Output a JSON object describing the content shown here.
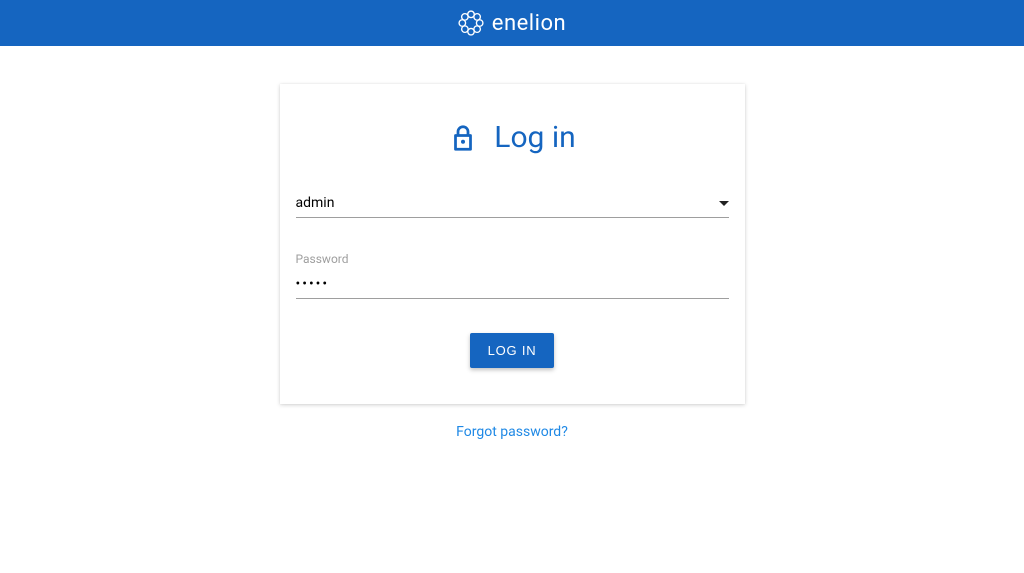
{
  "header": {
    "brand": "enelion"
  },
  "login": {
    "title": "Log in",
    "user_select": {
      "value": "admin"
    },
    "password": {
      "label": "Password",
      "value": "•••••"
    },
    "button_label": "LOG IN",
    "forgot_label": "Forgot password?"
  },
  "colors": {
    "primary": "#1565c0"
  }
}
